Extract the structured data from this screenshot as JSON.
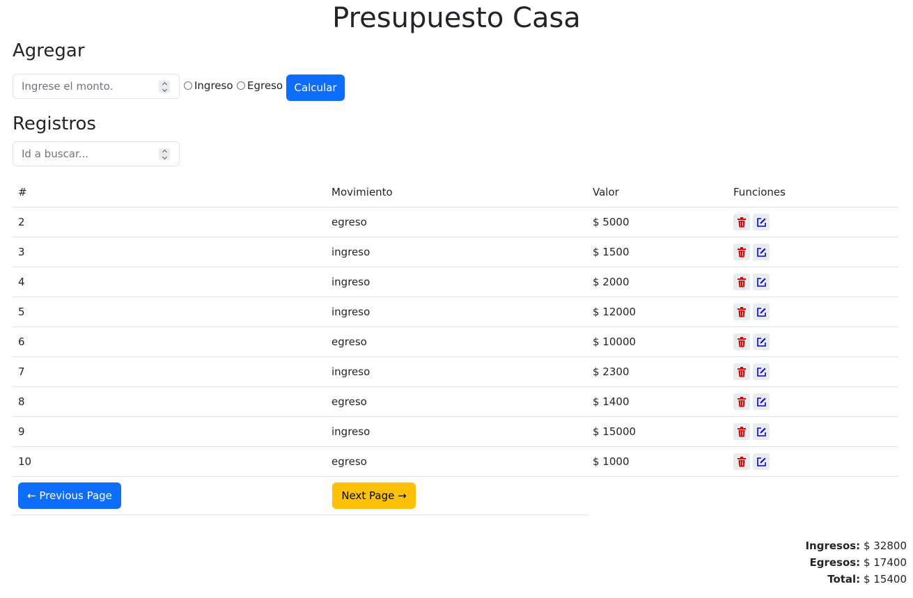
{
  "title": "Presupuesto Casa",
  "add_section": {
    "heading": "Agregar",
    "amount_placeholder": "Ingrese el monto.",
    "radio_income": "Ingreso",
    "radio_expense": "Egreso",
    "calculate_label": "Calcular"
  },
  "records_section": {
    "heading": "Registros",
    "search_placeholder": "Id a buscar..."
  },
  "table": {
    "headers": [
      "#",
      "Movimiento",
      "Valor",
      "Funciones"
    ],
    "rows": [
      {
        "id": "2",
        "movement": "egreso",
        "value": "$ 5000"
      },
      {
        "id": "3",
        "movement": "ingreso",
        "value": "$ 1500"
      },
      {
        "id": "4",
        "movement": "ingreso",
        "value": "$ 2000"
      },
      {
        "id": "5",
        "movement": "ingreso",
        "value": "$ 12000"
      },
      {
        "id": "6",
        "movement": "egreso",
        "value": "$ 10000"
      },
      {
        "id": "7",
        "movement": "ingreso",
        "value": "$ 2300"
      },
      {
        "id": "8",
        "movement": "egreso",
        "value": "$ 1400"
      },
      {
        "id": "9",
        "movement": "ingreso",
        "value": "$ 15000"
      },
      {
        "id": "10",
        "movement": "egreso",
        "value": "$ 1000"
      }
    ]
  },
  "pagination": {
    "previous_label": "← Previous Page",
    "next_label": "Next Page →"
  },
  "totals": {
    "income_label": "Ingresos:",
    "income_value": "$ 32800",
    "expense_label": "Egresos:",
    "expense_value": "$ 17400",
    "total_label": "Total:",
    "total_value": "$ 15400"
  },
  "icons": {
    "delete": "trash-icon",
    "edit": "edit-icon",
    "delete_color": "#e00000",
    "edit_color": "#0000e0"
  },
  "colors": {
    "primary": "#0d6efd",
    "warning": "#ffc107"
  }
}
